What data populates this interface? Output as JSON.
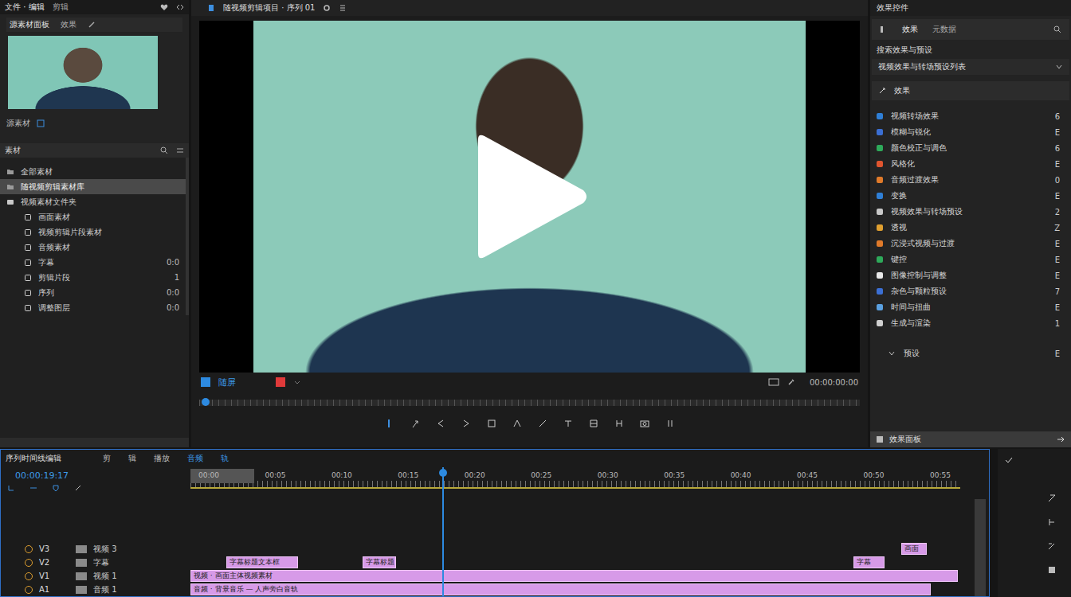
{
  "app_bar": {
    "tabs": [
      {
        "label": "文件 · 编辑",
        "selected": true
      },
      {
        "label": "剪辑",
        "selected": false
      }
    ]
  },
  "source_panel": {
    "tabs": [
      {
        "label": "源素材面板",
        "selected": true
      },
      {
        "label": "效果",
        "selected": false
      }
    ],
    "caption": "源素材"
  },
  "project_panel": {
    "title": "素材",
    "items": [
      {
        "label": "全部素材",
        "kind": "folder",
        "selected": false,
        "meta": ""
      },
      {
        "label": "随视频剪辑素材库",
        "kind": "folder",
        "selected": true,
        "meta": ""
      },
      {
        "label": "视频素材文件夹",
        "kind": "bin",
        "selected": false,
        "meta": ""
      },
      {
        "label": "画面素材",
        "kind": "file",
        "selected": false,
        "meta": ""
      },
      {
        "label": "视频剪辑片段素材",
        "kind": "file",
        "selected": false,
        "meta": ""
      },
      {
        "label": "音频素材",
        "kind": "file",
        "selected": false,
        "meta": ""
      },
      {
        "label": "字幕",
        "kind": "file",
        "selected": false,
        "meta": "0:0"
      },
      {
        "label": "剪辑片段",
        "kind": "file",
        "selected": false,
        "meta": "1"
      },
      {
        "label": "序列",
        "kind": "file",
        "selected": false,
        "meta": "0:0"
      },
      {
        "label": "调整图层",
        "kind": "file",
        "selected": false,
        "meta": "0:0"
      }
    ]
  },
  "preview": {
    "title": "随视频剪辑项目 · 序列 01",
    "sequence_label": "随屏",
    "timecode": "00:00:00:00",
    "scrub_level": 0.01
  },
  "effects_panel": {
    "title": "效果控件",
    "tabs": [
      {
        "label": "效果",
        "selected": true
      },
      {
        "label": "元数据",
        "selected": false
      }
    ],
    "search_label": "搜索效果与预设",
    "dropdown": "视频效果与转场预设列表",
    "section": "效果",
    "items": [
      {
        "label": "视频转场效果",
        "color": "#2f7fd6",
        "badge": "6"
      },
      {
        "label": "模糊与锐化",
        "color": "#3b6fd4",
        "badge": "E"
      },
      {
        "label": "颜色校正与调色",
        "color": "#2eaa5a",
        "badge": "6"
      },
      {
        "label": "风格化",
        "color": "#e0552f",
        "badge": "E"
      },
      {
        "label": "音频过渡效果",
        "color": "#e07a2a",
        "badge": "0"
      },
      {
        "label": "变换",
        "color": "#2f7fd6",
        "badge": "E"
      },
      {
        "label": "视频效果与转场预设",
        "color": "#c8c8c8",
        "badge": "2"
      },
      {
        "label": "透视",
        "color": "#e0a030",
        "badge": "Z"
      },
      {
        "label": "沉浸式视频与过渡",
        "color": "#e07a2a",
        "badge": "E"
      },
      {
        "label": "键控",
        "color": "#2eaa5a",
        "badge": "E"
      },
      {
        "label": "图像控制与调整",
        "color": "#e8e8e8",
        "badge": "E"
      },
      {
        "label": "杂色与颗粒预设",
        "color": "#3b6fd4",
        "badge": "7"
      },
      {
        "label": "时间与扭曲",
        "color": "#5aa0e0",
        "badge": "E"
      },
      {
        "label": "生成与渲染",
        "color": "#d0d0d0",
        "badge": "1"
      }
    ],
    "more": {
      "label": "预设",
      "badge": "E"
    },
    "footer": "效果面板"
  },
  "timeline": {
    "title": "序列时间线编辑",
    "tabs": [
      {
        "label": "剪",
        "selected": false
      },
      {
        "label": "辑",
        "selected": false
      },
      {
        "label": "播放",
        "selected": false
      },
      {
        "label": "音频",
        "selected": true
      },
      {
        "label": "轨",
        "selected": true
      }
    ],
    "timecode": "00:00:19:17",
    "duration": 60,
    "playhead": 19.7,
    "work_area": {
      "start": 0,
      "end": 5
    },
    "ruler": [
      "00:00",
      "00:05",
      "00:10",
      "00:15",
      "00:20",
      "00:25",
      "00:30",
      "00:35",
      "00:40",
      "00:45",
      "00:50",
      "00:55"
    ],
    "tracks": [
      {
        "name": "V3",
        "label": "视频 3",
        "clips": [
          {
            "label": "画面",
            "start": 55.4,
            "end": 57.4
          }
        ]
      },
      {
        "name": "V2",
        "label": "字幕",
        "clips": [
          {
            "label": "字幕标题文本框",
            "start": 2.8,
            "end": 8.4
          },
          {
            "label": "字幕标题",
            "start": 13.4,
            "end": 16.0
          },
          {
            "label": "字幕",
            "start": 51.7,
            "end": 54.1
          }
        ]
      },
      {
        "name": "V1",
        "label": "视频 1",
        "clips": [
          {
            "label": "视频 · 画面主体视频素材",
            "start": 0,
            "end": 59.8
          }
        ]
      },
      {
        "name": "A1",
        "label": "音频 1",
        "clips": [
          {
            "label": "音频 · 背景音乐 — 人声旁白音轨",
            "start": 0,
            "end": 57.7
          }
        ]
      }
    ]
  }
}
